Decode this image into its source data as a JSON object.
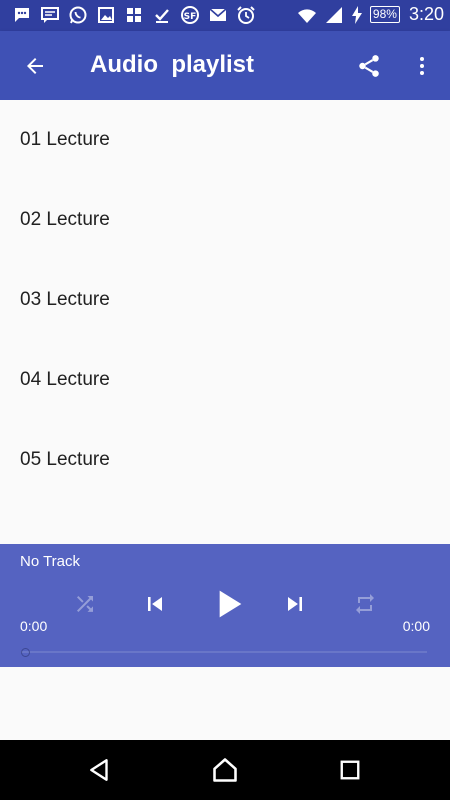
{
  "status_bar": {
    "left_icons": [
      "chat-bubble-icon",
      "message-icon",
      "whatsapp-icon",
      "image-icon",
      "flag-icon",
      "download-done-icon",
      "sf-app-icon",
      "mail-icon",
      "alarm-icon"
    ],
    "battery": "98%",
    "time": "3:20"
  },
  "app_bar": {
    "title": "Audio  playlist"
  },
  "playlist": {
    "items": [
      "01 Lecture",
      "02 Lecture",
      "03 Lecture",
      "04 Lecture",
      "05 Lecture"
    ]
  },
  "player": {
    "now_playing": "No Track",
    "current_time": "0:00",
    "total_time": "0:00",
    "progress": 0
  },
  "colors": {
    "status_bar": "#303f9f",
    "app_bar": "#3f51b5",
    "player": "#5563c1",
    "nav_bar": "#000000"
  }
}
